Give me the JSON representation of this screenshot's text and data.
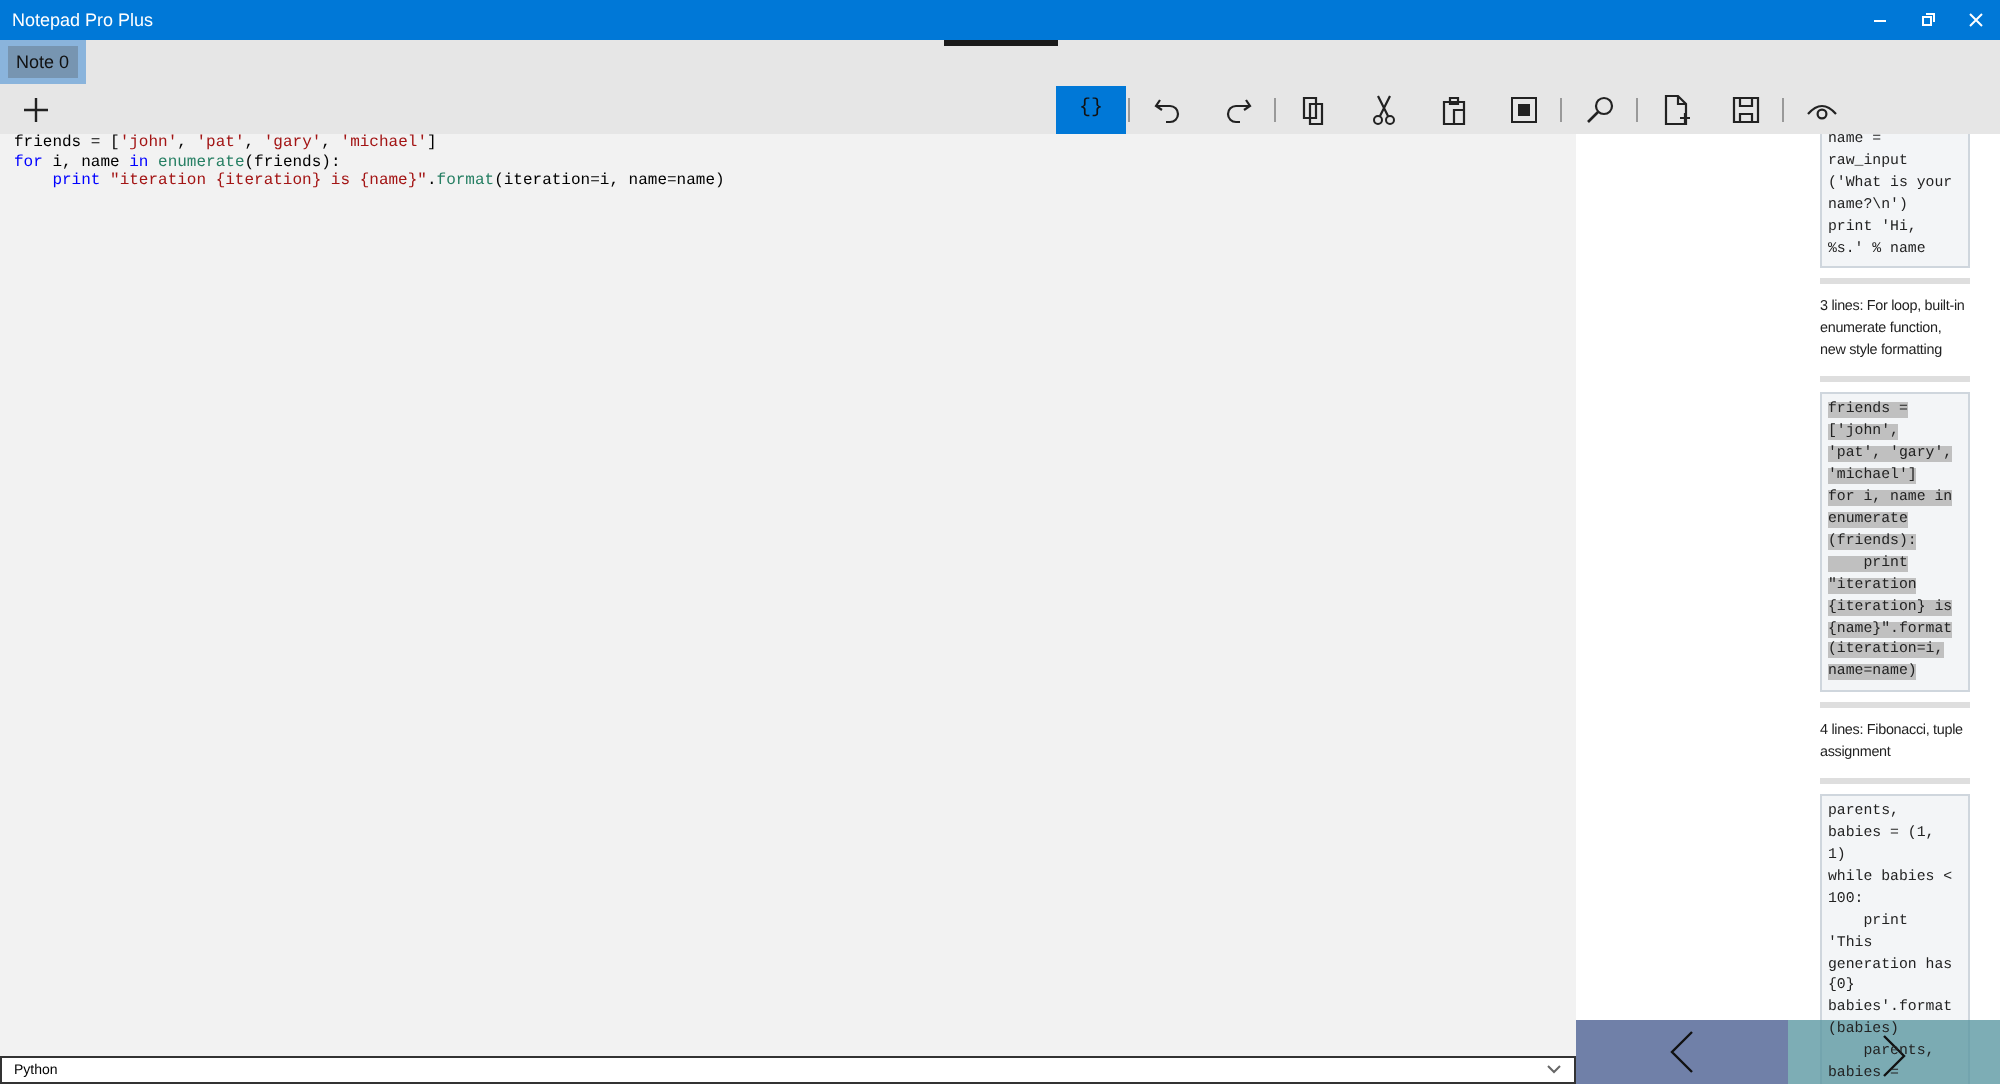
{
  "window": {
    "title": "Notepad Pro Plus"
  },
  "tabs": [
    {
      "label": "Note 0",
      "selected": true
    }
  ],
  "toolbar": [
    {
      "kind": "button",
      "label": "{}",
      "selected": true
    },
    {
      "kind": "separator"
    },
    {
      "kind": "button",
      "selected": false
    },
    {
      "kind": "button",
      "selected": false
    },
    {
      "kind": "separator"
    },
    {
      "kind": "button",
      "selected": false
    },
    {
      "kind": "button",
      "selected": false
    },
    {
      "kind": "button",
      "selected": false
    },
    {
      "kind": "button",
      "selected": false
    },
    {
      "kind": "separator"
    },
    {
      "kind": "button",
      "selected": false
    },
    {
      "kind": "separator"
    },
    {
      "kind": "button",
      "selected": false
    },
    {
      "kind": "button",
      "selected": false
    },
    {
      "kind": "separator"
    },
    {
      "kind": "button",
      "selected": false
    }
  ],
  "editor": {
    "lines": [
      [
        {
          "kind": "plain",
          "text": "friends = ["
        },
        {
          "kind": "string",
          "text": "'john'"
        },
        {
          "kind": "plain",
          "text": ", "
        },
        {
          "kind": "string",
          "text": "'pat'"
        },
        {
          "kind": "plain",
          "text": ", "
        },
        {
          "kind": "string",
          "text": "'gary'"
        },
        {
          "kind": "plain",
          "text": ", "
        },
        {
          "kind": "string",
          "text": "'michael'"
        },
        {
          "kind": "plain",
          "text": "]"
        }
      ],
      [
        {
          "kind": "keyword",
          "text": "for"
        },
        {
          "kind": "plain",
          "text": " i, name "
        },
        {
          "kind": "keyword",
          "text": "in "
        },
        {
          "kind": "builtin",
          "text": "enumerate"
        },
        {
          "kind": "plain",
          "text": "(friends):"
        }
      ],
      [
        {
          "kind": "keyword",
          "text": "    print "
        },
        {
          "kind": "string",
          "text": "\"iteration {iteration} is {name}\""
        },
        {
          "kind": "plain",
          "text": "."
        },
        {
          "kind": "builtin",
          "text": "format"
        },
        {
          "kind": "plain",
          "text": "(iteration=i, name=name)"
        }
      ]
    ]
  },
  "language": {
    "value": "Python"
  },
  "examples": [
    {
      "kind": "code",
      "selected": false,
      "lines": [
        "name =",
        "raw_input",
        "('What is your",
        "name?\\n')",
        "print 'Hi,",
        "%s.' % name"
      ]
    },
    {
      "kind": "description",
      "text": "3 lines: For loop, built-in enumerate function, new style formatting"
    },
    {
      "kind": "code",
      "selected": true,
      "lines": [
        "friends =",
        "['john',",
        "'pat', 'gary',",
        "'michael']",
        "for i, name in",
        "enumerate",
        "(friends):",
        "    print",
        "\"iteration",
        "{iteration} is",
        "{name}\".format",
        "(iteration=i,",
        "name=name)"
      ]
    },
    {
      "kind": "description",
      "text": "4 lines: Fibonacci, tuple assignment"
    },
    {
      "kind": "code",
      "selected": false,
      "lines": [
        "parents,",
        "babies = (1,",
        "1)",
        "while babies <",
        "100:",
        "    print",
        "'This",
        "generation has",
        "{0}",
        "babies'.format",
        "(babies)",
        "    parents,",
        "babies ="
      ]
    }
  ]
}
